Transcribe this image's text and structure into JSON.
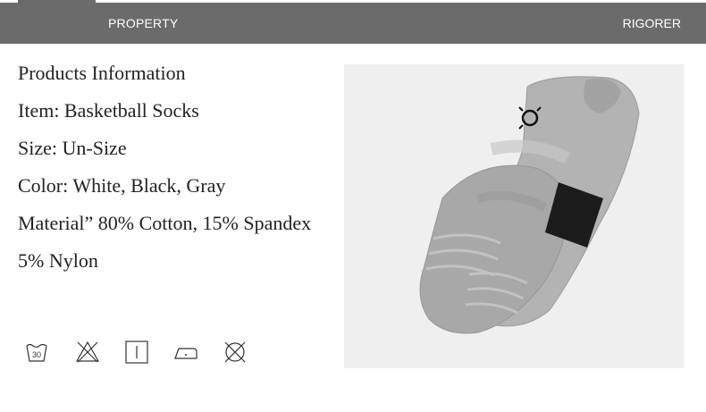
{
  "header": {
    "left_label": "PROPERTY",
    "right_label": "RIGORER"
  },
  "info": {
    "lines": [
      "Products Information",
      "Item: Basketball Socks",
      "Size: Un-Size",
      "Color: White, Black, Gray",
      "Material” 80% Cotton, 15% Spandex",
      "5% Nylon"
    ]
  },
  "care": {
    "wash_temp": "30",
    "icons": [
      "wash-30-icon",
      "no-bleach-icon",
      "tumble-dry-icon",
      "iron-icon",
      "no-dry-clean-icon"
    ]
  },
  "product_image": {
    "name": "basketball-socks-photo",
    "colors": {
      "sock": "#a9a9a9",
      "panel": "#1c1c1c",
      "background": "#efefef"
    }
  },
  "theme": {
    "header_bg": "#6b6b6b",
    "text": "#222222"
  }
}
